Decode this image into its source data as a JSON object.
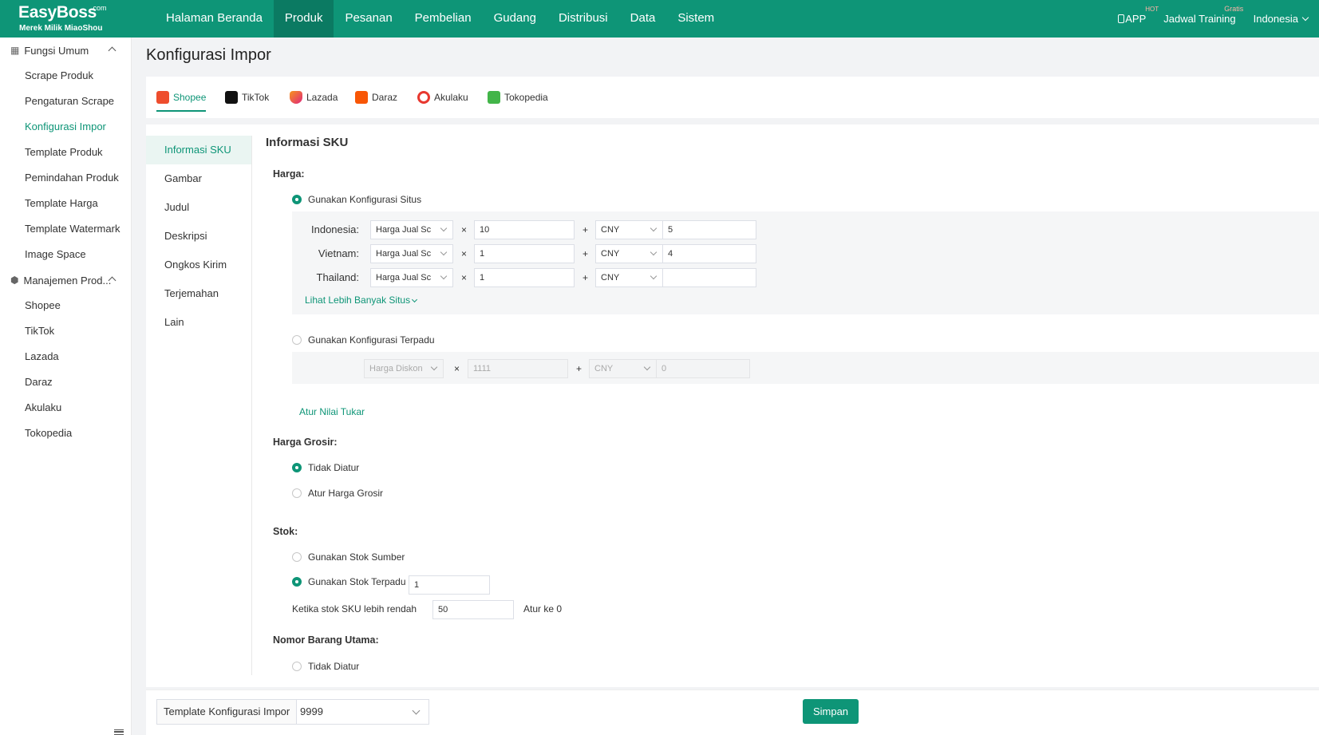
{
  "brand": {
    "name": "EasyBoss",
    "suffix": ".com",
    "tagline": "Merek Milik MiaoShou"
  },
  "nav": [
    "Halaman Beranda",
    "Produk",
    "Pesanan",
    "Pembelian",
    "Gudang",
    "Distribusi",
    "Data",
    "Sistem"
  ],
  "nav_active": "Produk",
  "top_right": {
    "app": "APP",
    "app_badge": "HOT",
    "training": "Jadwal Training",
    "training_badge": "Gratis",
    "language": "Indonesia"
  },
  "sidebar": {
    "group1": "Fungsi Umum",
    "group1_items": [
      "Scrape Produk",
      "Pengaturan Scrape",
      "Konfigurasi Impor",
      "Template Produk",
      "Pemindahan Produk",
      "Template Harga",
      "Template Watermark",
      "Image Space"
    ],
    "group2": "Manajemen Prod...",
    "group2_items": [
      "Shopee",
      "TikTok",
      "Lazada",
      "Daraz",
      "Akulaku",
      "Tokopedia"
    ]
  },
  "page_title": "Konfigurasi Impor",
  "platform_tabs": [
    "Shopee",
    "TikTok",
    "Lazada",
    "Daraz",
    "Akulaku",
    "Tokopedia"
  ],
  "subnav": [
    "Informasi SKU",
    "Gambar",
    "Judul",
    "Deskripsi",
    "Ongkos Kirim",
    "Terjemahan",
    "Lain"
  ],
  "section_title": "Informasi SKU",
  "price": {
    "label": "Harga:",
    "opt_site": "Gunakan Konfigurasi Situs",
    "sites": [
      {
        "name": "Indonesia:",
        "price_type": "Harga Jual Sc",
        "multiplier": "10",
        "currency": "CNY",
        "add": "5"
      },
      {
        "name": "Vietnam:",
        "price_type": "Harga Jual Sc",
        "multiplier": "1",
        "currency": "CNY",
        "add": "4"
      },
      {
        "name": "Thailand:",
        "price_type": "Harga Jual Sc",
        "multiplier": "1",
        "currency": "CNY",
        "add": ""
      }
    ],
    "more_sites": "Lihat Lebih Banyak Situs",
    "opt_unified": "Gunakan Konfigurasi Terpadu",
    "unified": {
      "price_type": "Harga Diskon",
      "multiplier": "1111",
      "currency": "CNY",
      "add": "0"
    },
    "exchange_link": "Atur Nilai Tukar",
    "times": "×",
    "plus": "+"
  },
  "wholesale": {
    "label": "Harga Grosir:",
    "opt_none": "Tidak Diatur",
    "opt_set": "Atur Harga Grosir"
  },
  "stock": {
    "label": "Stok:",
    "opt_source": "Gunakan Stok Sumber",
    "opt_unified": "Gunakan Stok Terpadu",
    "unified_value": "1",
    "low_label": "Ketika stok SKU lebih rendah",
    "low_value": "50",
    "low_suffix": "Atur ke 0"
  },
  "main_item": {
    "label": "Nomor Barang Utama:",
    "opt_none": "Tidak Diatur"
  },
  "footer": {
    "template_label": "Template Konfigurasi Impor",
    "template_value": "9999",
    "save": "Simpan"
  },
  "colors": {
    "primary": "#0e9577",
    "nav_active": "#0b7a62"
  }
}
